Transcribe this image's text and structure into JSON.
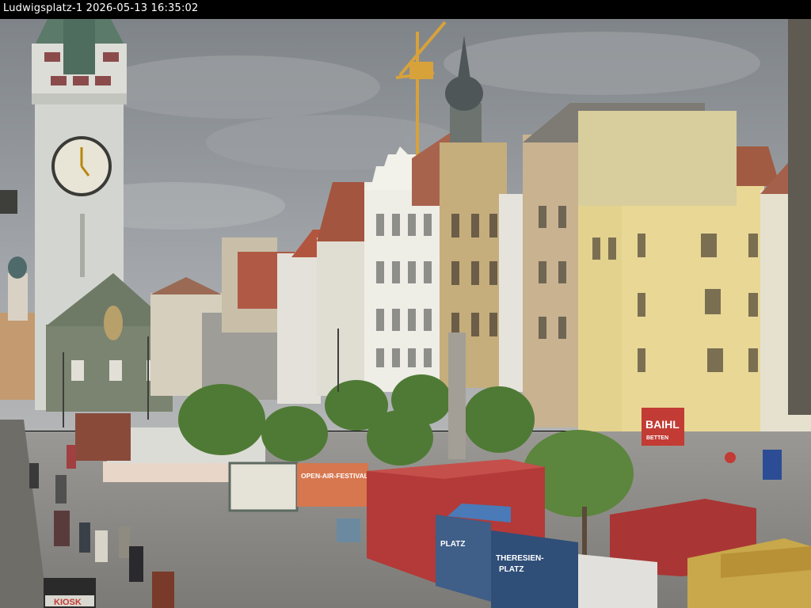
{
  "camera": {
    "caption": "Ludwigsplatz-1 2026-05-13 16:35:02"
  },
  "signs": {
    "festival_banner": "OPEN-AIR-FESTIVAL",
    "brand_sign_top": "BAIHL",
    "brand_sign_bottom": "BETTEN",
    "blue_board_left": "PLATZ",
    "blue_board_right_1": "THERESIEN-",
    "blue_board_right_2": "PLATZ",
    "kiosk": "KIOSK"
  },
  "colors": {
    "sky": "#8d9196",
    "tower": "#d3d6d0",
    "pavement": "#8b8a86",
    "container": "#b33a38",
    "trees": "#4f7a35"
  }
}
